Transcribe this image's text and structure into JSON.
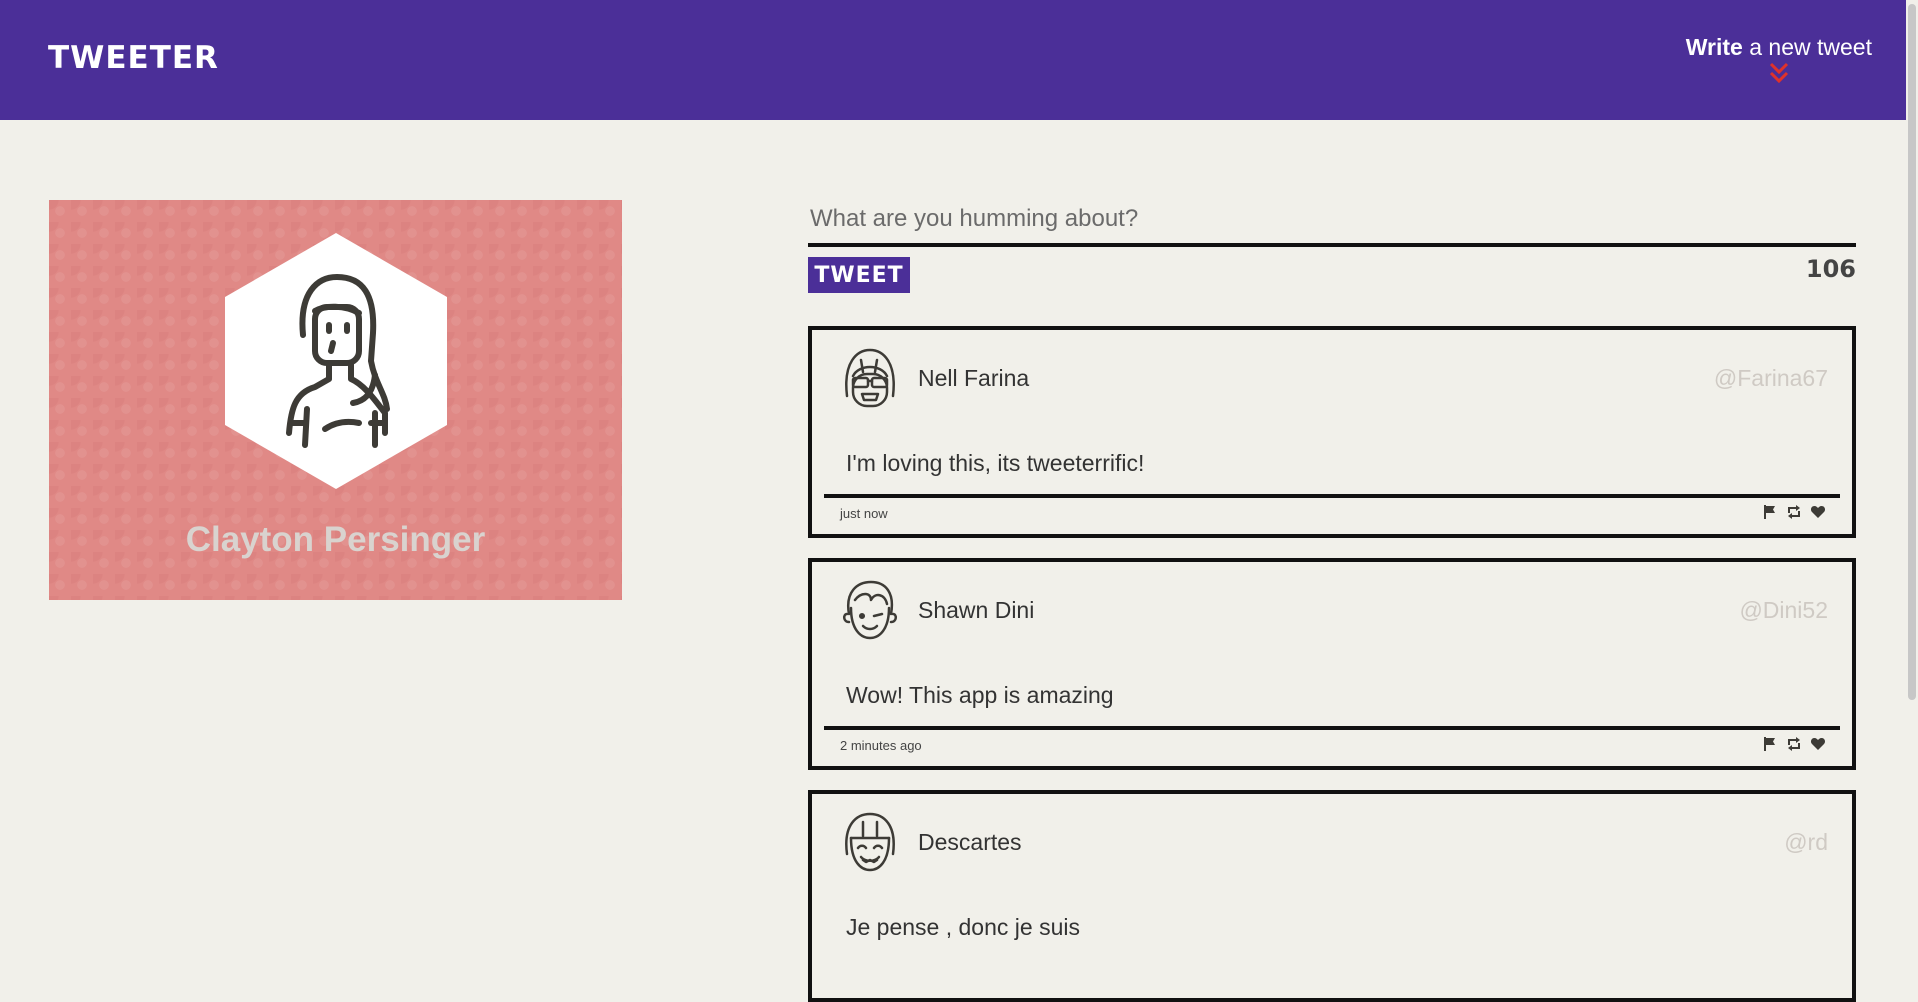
{
  "nav": {
    "brand": "TWEETER",
    "compose_bold": "Write",
    "compose_rest": " a new tweet",
    "compose_icon": "double-chevron-down-icon",
    "accent": "#4b2f98",
    "chevron_color": "#e0322a"
  },
  "profile": {
    "name": "Clayton Persinger",
    "background": "#e08986",
    "avatar_icon": "woman-long-hair-avatar"
  },
  "new_tweet": {
    "placeholder": "What are you humming about?",
    "button_label": "TWEET",
    "counter": "106"
  },
  "tweets": [
    {
      "name": "Nell Farina",
      "handle": "@Farina67",
      "content": "I'm loving this, its tweeterrific!",
      "time": "just now",
      "avatar_icon": "sunglasses-face-avatar"
    },
    {
      "name": "Shawn Dini",
      "handle": "@Dini52",
      "content": "Wow! This app is amazing",
      "time": "2 minutes ago",
      "avatar_icon": "winking-face-avatar"
    },
    {
      "name": "Descartes",
      "handle": "@rd",
      "content": "Je pense , donc je suis",
      "time": "",
      "avatar_icon": "smiling-bangs-face-avatar"
    }
  ],
  "actions": [
    "flag-icon",
    "retweet-icon",
    "heart-icon"
  ]
}
